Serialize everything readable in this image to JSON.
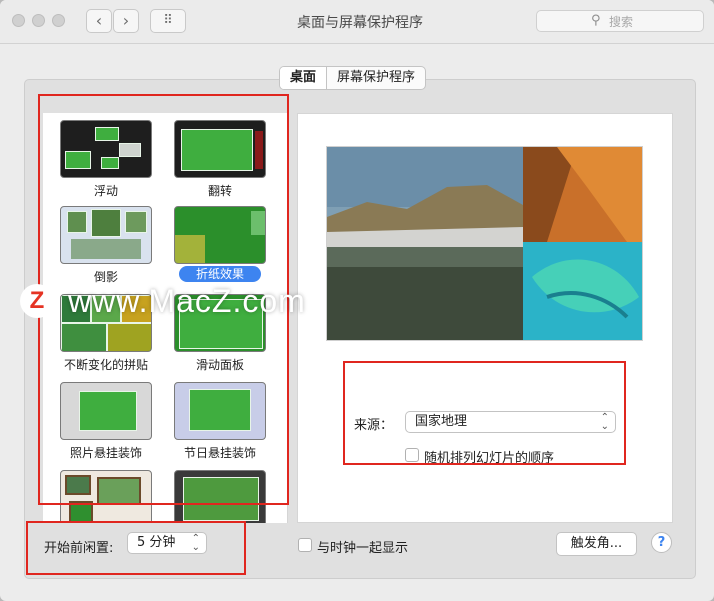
{
  "window": {
    "title": "桌面与屏幕保护程序",
    "nav_back": "‹",
    "nav_forward": "›",
    "grid_glyph": "⠿",
    "search_placeholder": "搜索",
    "search_icon": "⚲"
  },
  "tabs": [
    {
      "label": "桌面",
      "active": true
    },
    {
      "label": "屏幕保护程序",
      "active": false
    }
  ],
  "screensavers": [
    {
      "label": "浮动",
      "selected": false
    },
    {
      "label": "翻转",
      "selected": false
    },
    {
      "label": "倒影",
      "selected": false
    },
    {
      "label": "折纸效果",
      "selected": true
    },
    {
      "label": "不断变化的拼贴",
      "selected": false
    },
    {
      "label": "滑动面板",
      "selected": false
    },
    {
      "label": "照片悬挂装饰",
      "selected": false
    },
    {
      "label": "节日悬挂装饰",
      "selected": false
    }
  ],
  "options": {
    "source_label": "来源：",
    "source_value": "国家地理",
    "shuffle_label": "随机排列幻灯片的顺序",
    "shuffle_checked": false
  },
  "bottom": {
    "idle_label": "开始前闲置:",
    "idle_value": "5 分钟",
    "clock_label": "与时钟一起显示",
    "clock_checked": false,
    "hot_corners": "触发角...",
    "help": "?"
  },
  "watermark": {
    "logo": "Z",
    "text": "www.MacZ.com"
  },
  "colors": {
    "annotation_red": "#e0261f",
    "selection_blue": "#3d84f0"
  }
}
